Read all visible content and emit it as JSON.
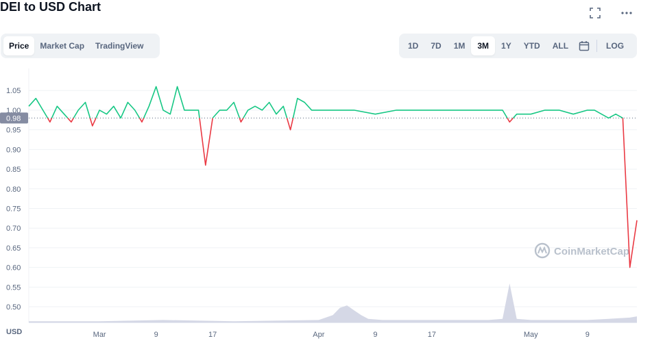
{
  "header": {
    "title": "DEI to USD Chart"
  },
  "icons": {
    "fullscreen": "fullscreen-icon",
    "more": "more-icon",
    "calendar": "calendar-icon",
    "watermark_logo": "coinmarketcap-logo"
  },
  "tabs_left": [
    "Price",
    "Market Cap",
    "TradingView"
  ],
  "active_left": "Price",
  "ranges": [
    "1D",
    "7D",
    "1M",
    "3M",
    "1Y",
    "YTD",
    "ALL"
  ],
  "active_range": "3M",
  "log_label": "LOG",
  "watermark": "CoinMarketCap",
  "current_price_label": "0.98",
  "colors": {
    "up": "#16c784",
    "down": "#ea3943",
    "volume": "#d5d8e6",
    "current_tag": "#858ca2",
    "grid": "#eff2f5"
  },
  "chart_data": {
    "type": "line",
    "ylabel": "USD",
    "ylim": [
      0.46,
      1.08
    ],
    "yticks": [
      "1.05",
      "1.00",
      "0.95",
      "0.90",
      "0.85",
      "0.80",
      "0.75",
      "0.70",
      "0.65",
      "0.60",
      "0.55",
      "0.50"
    ],
    "xticks": [
      "Mar",
      "9",
      "17",
      "Apr",
      "9",
      "17",
      "May",
      "9"
    ],
    "x_range": [
      "2022-02-19",
      "2022-05-16"
    ],
    "baseline": 0.98,
    "series": [
      {
        "x": [
          "2022-02-19",
          "2022-02-20",
          "2022-02-21",
          "2022-02-22",
          "2022-02-23",
          "2022-02-24",
          "2022-02-25",
          "2022-02-26",
          "2022-02-27",
          "2022-02-28",
          "2022-03-01",
          "2022-03-02",
          "2022-03-03",
          "2022-03-04",
          "2022-03-05",
          "2022-03-06",
          "2022-03-07",
          "2022-03-08",
          "2022-03-09",
          "2022-03-10",
          "2022-03-11",
          "2022-03-12",
          "2022-03-13",
          "2022-03-14",
          "2022-03-15",
          "2022-03-16",
          "2022-03-17",
          "2022-03-18",
          "2022-03-19",
          "2022-03-20",
          "2022-03-21",
          "2022-03-22",
          "2022-03-23",
          "2022-03-24",
          "2022-03-25",
          "2022-03-26",
          "2022-03-27",
          "2022-03-28",
          "2022-03-29",
          "2022-03-30",
          "2022-03-31",
          "2022-04-01",
          "2022-04-03",
          "2022-04-06",
          "2022-04-09",
          "2022-04-12",
          "2022-04-15",
          "2022-04-18",
          "2022-04-21",
          "2022-04-24",
          "2022-04-27",
          "2022-04-28",
          "2022-04-29",
          "2022-05-01",
          "2022-05-03",
          "2022-05-05",
          "2022-05-07",
          "2022-05-09",
          "2022-05-10",
          "2022-05-11",
          "2022-05-12",
          "2022-05-13",
          "2022-05-14",
          "2022-05-15",
          "2022-05-16"
        ],
        "values": [
          1.01,
          1.03,
          1.0,
          0.97,
          1.01,
          0.99,
          0.97,
          1.0,
          1.02,
          0.96,
          1.0,
          0.99,
          1.01,
          0.98,
          1.02,
          1.0,
          0.97,
          1.01,
          1.06,
          1.0,
          0.99,
          1.06,
          1.0,
          1.0,
          1.0,
          0.86,
          0.98,
          1.0,
          1.0,
          1.02,
          0.97,
          1.0,
          1.01,
          1.0,
          1.02,
          0.99,
          1.01,
          0.95,
          1.03,
          1.02,
          1.0,
          1.0,
          1.0,
          1.0,
          0.99,
          1.0,
          1.0,
          1.0,
          1.0,
          1.0,
          1.0,
          0.97,
          0.99,
          0.99,
          1.0,
          1.0,
          0.99,
          1.0,
          1.0,
          0.99,
          0.98,
          0.99,
          0.98,
          0.6,
          0.72
        ]
      }
    ],
    "volume": {
      "x": [
        "2022-02-19",
        "2022-03-01",
        "2022-03-10",
        "2022-03-20",
        "2022-04-01",
        "2022-04-03",
        "2022-04-04",
        "2022-04-05",
        "2022-04-06",
        "2022-04-07",
        "2022-04-08",
        "2022-04-10",
        "2022-04-15",
        "2022-04-20",
        "2022-04-25",
        "2022-04-27",
        "2022-04-28",
        "2022-04-29",
        "2022-05-01",
        "2022-05-05",
        "2022-05-09",
        "2022-05-12",
        "2022-05-15",
        "2022-05-16"
      ],
      "values": [
        1,
        1,
        2,
        1,
        2,
        6,
        12,
        14,
        10,
        6,
        3,
        2,
        2,
        2,
        2,
        3,
        32,
        3,
        2,
        2,
        2,
        3,
        4,
        5
      ]
    }
  }
}
